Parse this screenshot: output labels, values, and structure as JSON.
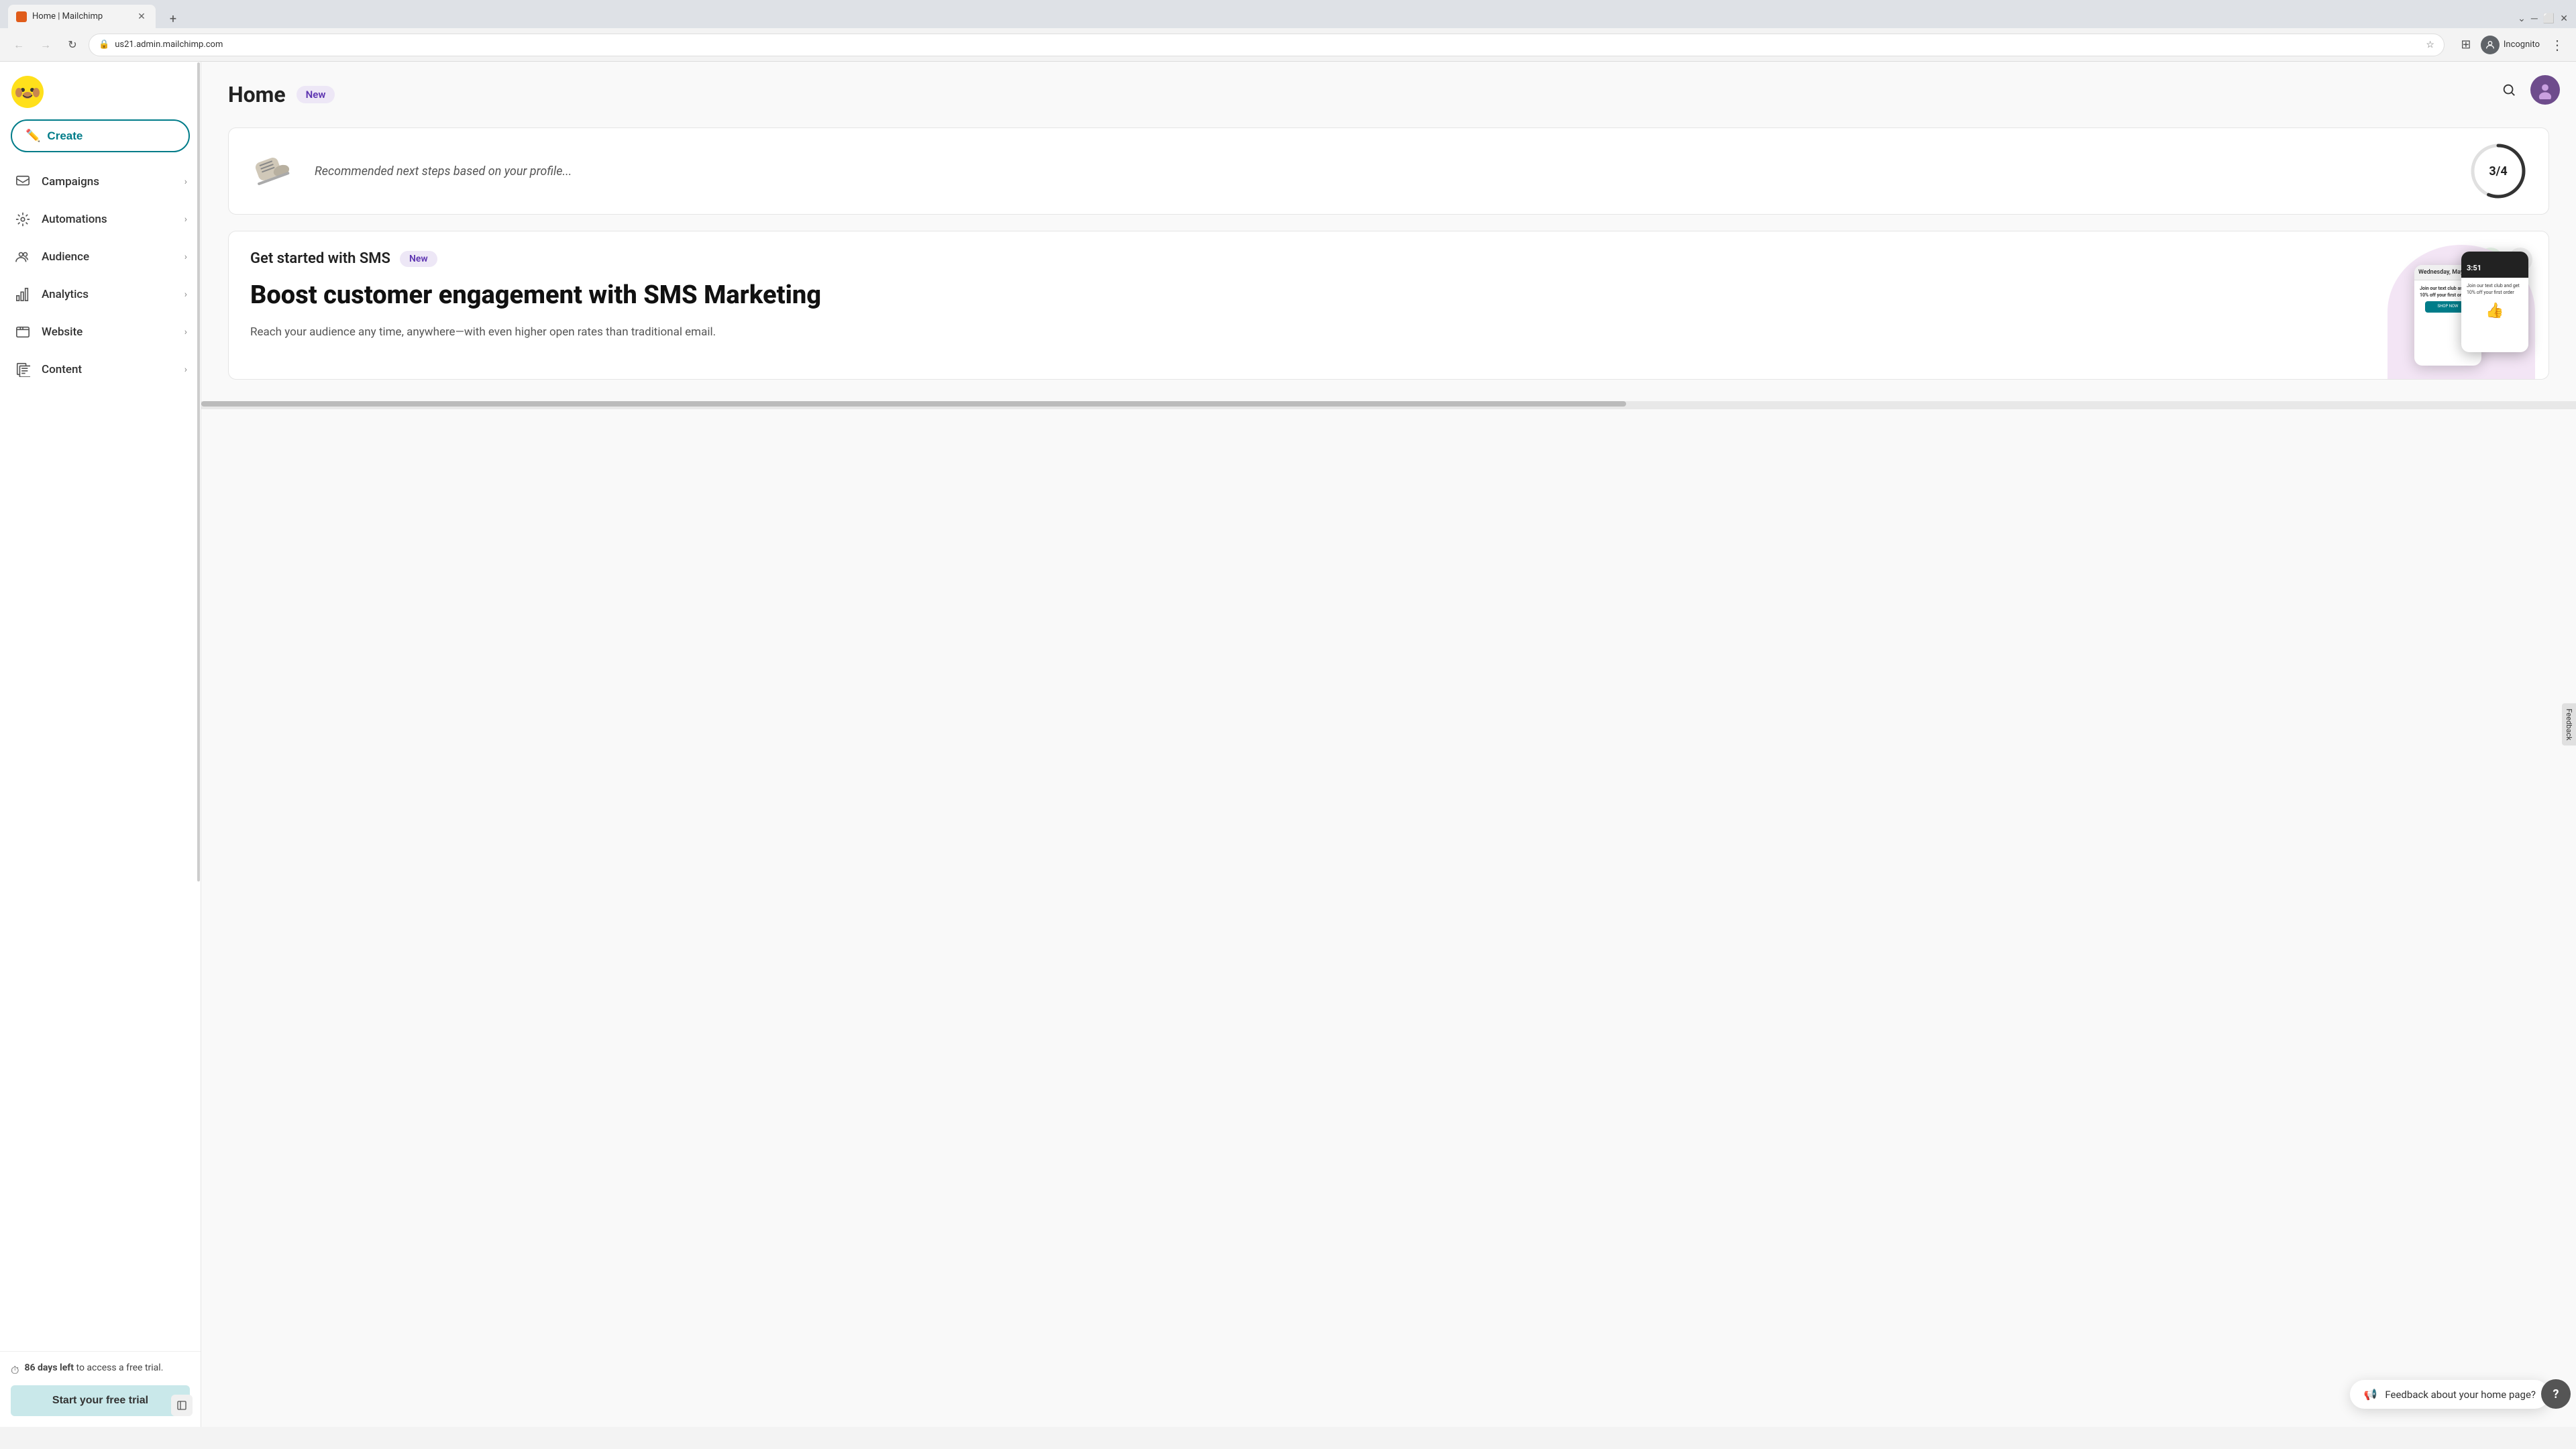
{
  "browser": {
    "tab_title": "Home | Mailchimp",
    "url": "us21.admin.mailchimp.com",
    "incognito_label": "Incognito"
  },
  "sidebar": {
    "create_label": "Create",
    "nav_items": [
      {
        "id": "campaigns",
        "label": "Campaigns"
      },
      {
        "id": "automations",
        "label": "Automations"
      },
      {
        "id": "audience",
        "label": "Audience"
      },
      {
        "id": "analytics",
        "label": "Analytics"
      },
      {
        "id": "website",
        "label": "Website"
      },
      {
        "id": "content",
        "label": "Content"
      }
    ],
    "days_left_bold": "86 days left",
    "days_left_rest": " to access a free trial.",
    "trial_button_label": "Start your free trial"
  },
  "main": {
    "page_title": "Home",
    "page_badge": "New",
    "recommended_text": "Recommended next steps based on your profile...",
    "progress_current": "3",
    "progress_total": "4",
    "progress_display": "3/4",
    "sms_section": {
      "title": "Get started with SMS",
      "badge": "New",
      "headline": "Boost customer engagement with SMS Marketing",
      "description": "Reach your audience any time, anywhere—with even higher open rates than traditional email."
    },
    "feedback_label": "Feedback about your home page?"
  }
}
